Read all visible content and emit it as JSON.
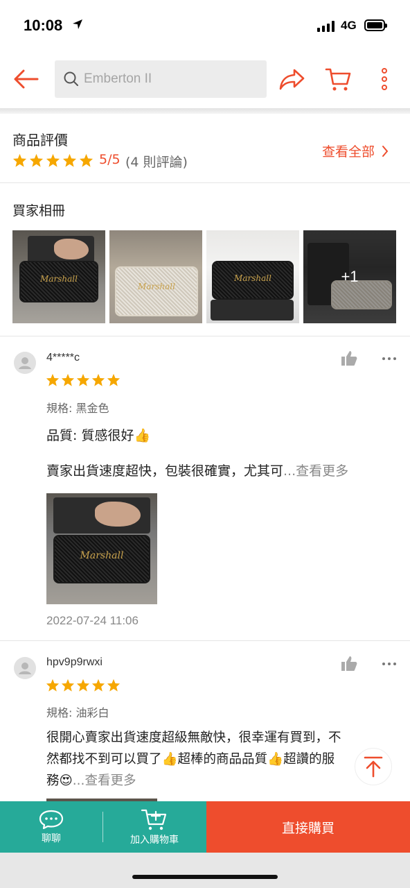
{
  "status_bar": {
    "time": "10:08",
    "network": "4G"
  },
  "header": {
    "search_placeholder": "Emberton II"
  },
  "summary": {
    "title": "商品評價",
    "stars": 5,
    "rating": "5/5",
    "count": "(4 則評論)",
    "see_all": "查看全部"
  },
  "album": {
    "title": "買家相冊",
    "more_count": "+1"
  },
  "reviews": [
    {
      "username": "4*****c",
      "stars": 5,
      "spec": "規格: 黑金色",
      "quality": "品質: 質感很好👍",
      "body": "賣家出貨速度超快，包裝很確實，尤其可",
      "see_more": "...查看更多",
      "date": "2022-07-24 11:06"
    },
    {
      "username": "hpv9p9rwxi",
      "stars": 5,
      "spec": "規格: 油彩白",
      "body_line1": "很開心賣家出貨速度超級無敵快，很幸運有買到，不",
      "body_line2": "然都找不到可以買了👍超棒的商品品質👍超讚的服",
      "body_line3": "務😍",
      "see_more": "...查看更多"
    }
  ],
  "bottom_bar": {
    "chat": "聊聊",
    "add_to_cart": "加入購物車",
    "buy_now": "直接購買"
  },
  "colors": {
    "accent": "#ee4d2d",
    "teal": "#26aa99",
    "star": "#f6a700"
  }
}
